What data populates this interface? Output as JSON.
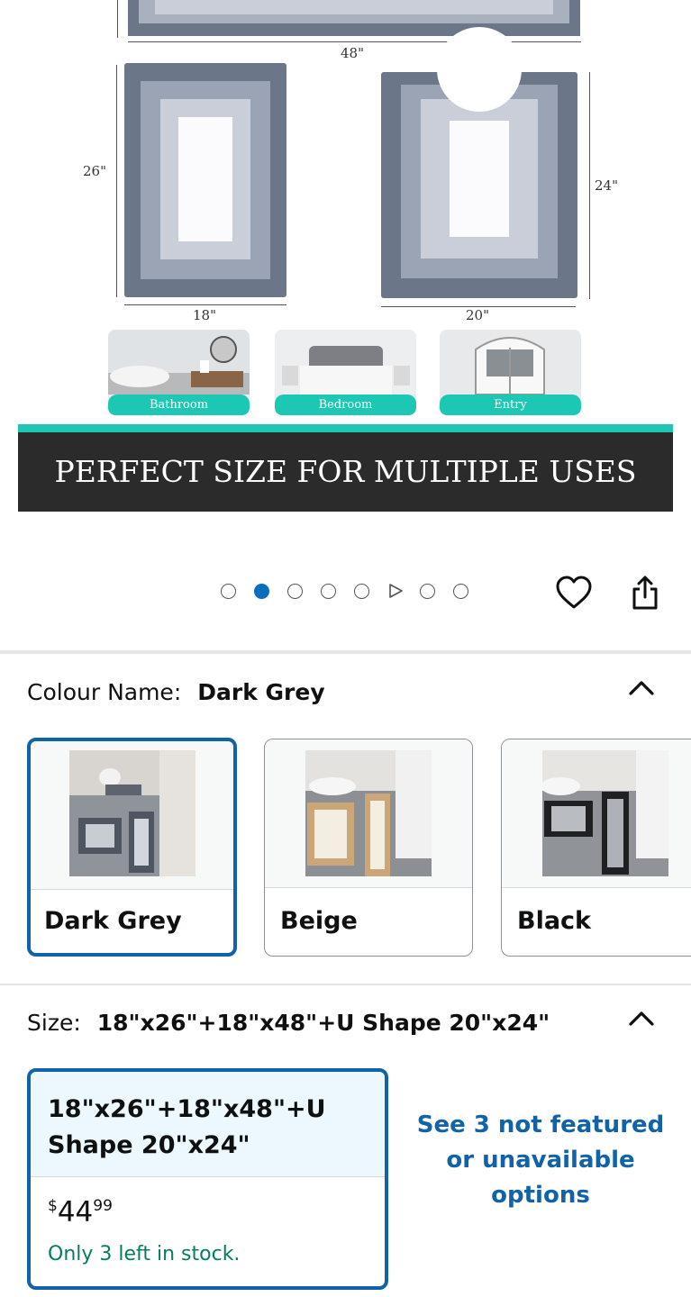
{
  "hero": {
    "dimensions": {
      "top_width": "48\"",
      "rug1_height": "26\"",
      "rug1_width": "18\"",
      "rug2_height": "24\"",
      "rug2_width": "20\""
    },
    "uses": [
      "Bathroom",
      "Bedroom",
      "Entry"
    ],
    "banner": "PERFECT SIZE FOR MULTIPLE USES"
  },
  "carousel": {
    "dot_count": 8,
    "active_index": 1,
    "video_index": 5,
    "accent": "#0a6ebd"
  },
  "actions": {
    "wishlist_icon": "heart-icon",
    "share_icon": "share-icon"
  },
  "colour": {
    "label": "Colour Name:",
    "value": "Dark Grey",
    "options": [
      {
        "name": "Dark Grey",
        "selected": true
      },
      {
        "name": "Beige",
        "selected": false
      },
      {
        "name": "Black",
        "selected": false
      }
    ]
  },
  "size": {
    "label": "Size:",
    "value": "18\"x26\"+18\"x48\"+U Shape 20\"x24\"",
    "selected_option": {
      "title": "18\"x26\"+18\"x48\"+U Shape 20\"x24\"",
      "price_symbol": "$",
      "price_whole": "44",
      "price_fraction": "99",
      "stock": "Only 3 left in stock."
    },
    "more_options": "See 3 not featured or unavailable options"
  },
  "colors": {
    "selected_border": "#1063a8",
    "stock_green": "#067d62",
    "teal": "#1cc7b4"
  }
}
